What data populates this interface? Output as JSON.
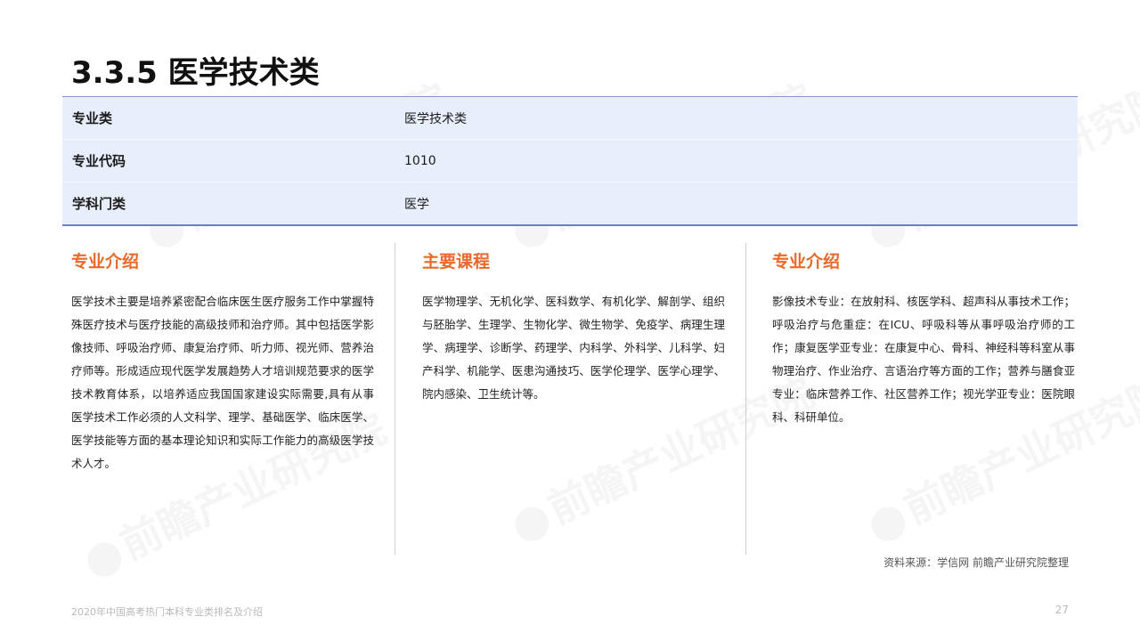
{
  "title": "3.3.5 医学技术类",
  "table": [
    {
      "key": "专业类",
      "value": "医学技术类"
    },
    {
      "key": "专业代码",
      "value": "1010"
    },
    {
      "key": "学科门类",
      "value": "医学"
    }
  ],
  "columns": [
    {
      "title": "专业介绍",
      "body": "医学技术主要是培养紧密配合临床医生医疗服务工作中掌握特殊医疗技术与医疗技能的高级技师和治疗师。其中包括医学影像技师、呼吸治疗师、康复治疗师、听力师、视光师、营养治疗师等。形成适应现代医学发展趋势人才培训规范要求的医学技术教育体系，以培养适应我国国家建设实际需要,具有从事医学技术工作必须的人文科学、理学、基础医学、临床医学、医学技能等方面的基本理论知识和实际工作能力的高级医学技术人才。"
    },
    {
      "title": "主要课程",
      "body": "医学物理学、无机化学、医科数学、有机化学、解剖学、组织与胚胎学、生理学、生物化学、微生物学、免疫学、病理生理学、病理学、诊断学、药理学、内科学、外科学、儿科学、妇产科学、机能学、医患沟通技巧、医学伦理学、医学心理学、院内感染、卫生统计等。"
    },
    {
      "title": "专业介绍",
      "body": "影像技术专业：在放射科、核医学科、超声科从事技术工作；呼吸治疗与危重症：在ICU、呼吸科等从事呼吸治疗师的工作；康复医学亚专业：在康复中心、骨科、神经科等科室从事物理治疗、作业治疗、言语治疗等方面的工作；营养与膳食亚专业：临床营养工作、社区营养工作；视光学亚专业：医院眼科、科研单位。"
    }
  ],
  "source": "资料来源：学信网 前瞻产业研究院整理",
  "footer": {
    "left": "2020年中国高考热门本科专业类排名及介绍",
    "page": "27"
  },
  "watermark": "前瞻产业研究院"
}
